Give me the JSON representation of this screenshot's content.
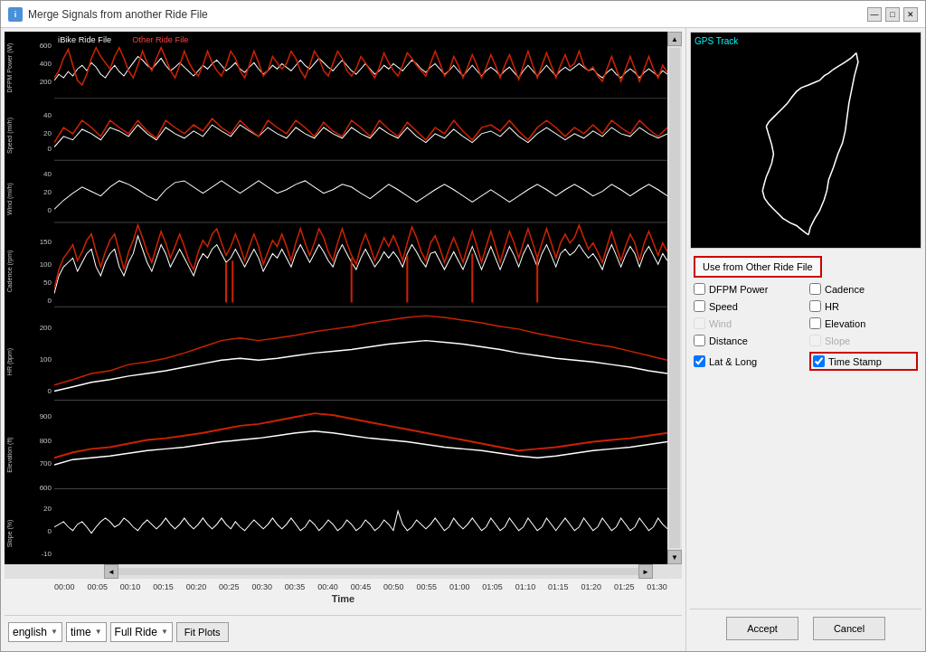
{
  "window": {
    "title": "Merge Signals from another Ride File",
    "icon": "i"
  },
  "titlebar": {
    "minimize_label": "—",
    "maximize_label": "□",
    "close_label": "✕"
  },
  "legend": {
    "ibike_label": "iBike Ride File",
    "other_label": "Other Ride File"
  },
  "time_axis": {
    "label": "Time",
    "ticks": [
      "00:00",
      "00:05",
      "00:10",
      "00:15",
      "00:20",
      "00:25",
      "00:30",
      "00:35",
      "00:40",
      "00:45",
      "00:50",
      "00:55",
      "01:00",
      "01:05",
      "01:10",
      "01:15",
      "01:20",
      "01:25",
      "01:30"
    ]
  },
  "y_sections": [
    {
      "label": "DFPM Power (W)",
      "max": 600,
      "mid": 400,
      "low": 200
    },
    {
      "label": "Speed (mi/h)",
      "max": 40,
      "mid": 20,
      "low": 0
    },
    {
      "label": "Wind (mi/h)",
      "max": 40,
      "mid": 20,
      "low": 0
    },
    {
      "label": "Cadence (rpm)",
      "max": 150,
      "mid": 100,
      "low": 50
    },
    {
      "label": "HR (bpm)",
      "max": 200,
      "mid": 100,
      "low": 0
    },
    {
      "label": "Elevation (ft)",
      "max": 900,
      "mid": 800,
      "low": 700
    },
    {
      "label": "Slope (%)",
      "max": 20,
      "mid": 0,
      "low": -10
    }
  ],
  "bottom_bar": {
    "language_value": "english",
    "time_value": "time",
    "ride_value": "Full Ride",
    "fit_plots_label": "Fit Plots"
  },
  "gps": {
    "label": "GPS Track"
  },
  "controls": {
    "use_from_label": "Use from Other Ride File",
    "checkboxes": [
      {
        "id": "dfpm",
        "label": "DFPM Power",
        "checked": false,
        "disabled": false
      },
      {
        "id": "cadence",
        "label": "Cadence",
        "checked": false,
        "disabled": false
      },
      {
        "id": "speed",
        "label": "Speed",
        "checked": false,
        "disabled": false
      },
      {
        "id": "hr",
        "label": "HR",
        "checked": false,
        "disabled": false
      },
      {
        "id": "wind",
        "label": "Wind",
        "checked": false,
        "disabled": true
      },
      {
        "id": "elevation",
        "label": "Elevation",
        "checked": false,
        "disabled": false
      },
      {
        "id": "distance",
        "label": "Distance",
        "checked": false,
        "disabled": false
      },
      {
        "id": "slope",
        "label": "Slope",
        "checked": false,
        "disabled": true
      },
      {
        "id": "latlng",
        "label": "Lat & Long",
        "checked": true,
        "disabled": false
      },
      {
        "id": "timestamp",
        "label": "Time Stamp",
        "checked": true,
        "disabled": false
      }
    ]
  },
  "buttons": {
    "accept_label": "Accept",
    "cancel_label": "Cancel"
  }
}
